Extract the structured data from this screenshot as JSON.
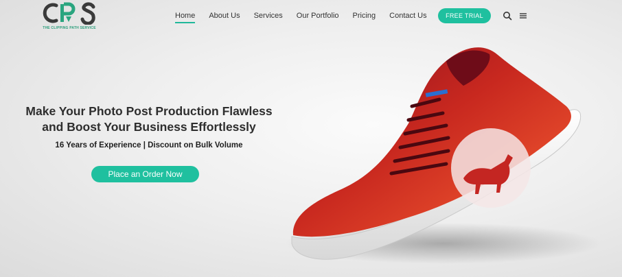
{
  "brand": {
    "logo_text": "CPS",
    "tagline": "THE CLIPPING PATH SERVICE",
    "accent_color": "#1fc09f"
  },
  "nav": {
    "items": [
      {
        "label": "Home",
        "active": true
      },
      {
        "label": "About Us",
        "active": false
      },
      {
        "label": "Services",
        "active": false
      },
      {
        "label": "Our Portfolio",
        "active": false
      },
      {
        "label": "Pricing",
        "active": false
      },
      {
        "label": "Contact Us",
        "active": false
      }
    ],
    "cta_label": "FREE TRIAL",
    "search_icon": "search-icon",
    "menu_icon": "hamburger-menu-icon"
  },
  "hero": {
    "headline_line1": "Make Your Photo Post Production Flawless",
    "headline_line2": "and Boost Your Business Effortlessly",
    "subline": "16 Years of Experience | Discount on Bulk Volume",
    "cta_label": "Place an Order Now",
    "image": "red-running-shoe"
  }
}
